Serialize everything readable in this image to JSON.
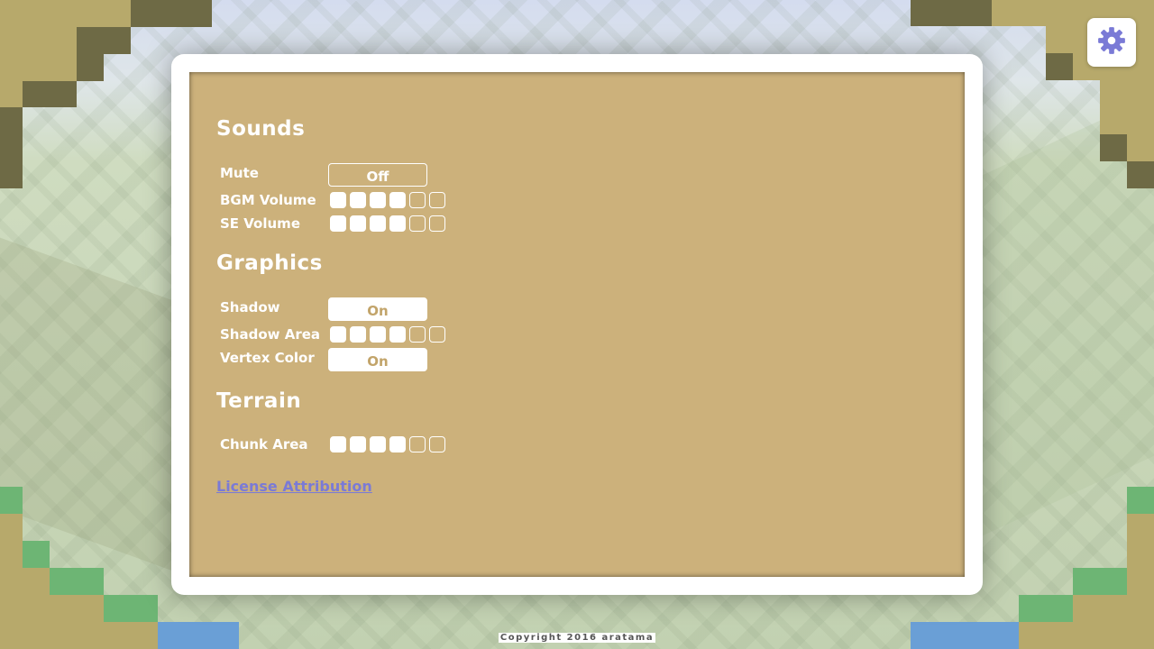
{
  "colors": {
    "panel_bg": "#ccb17b",
    "accent": "#7a7ad6",
    "frame_dark": "#6e6a45",
    "frame_sand": "#b7a96b",
    "grass": "#6db574",
    "water": "#6a9fd6"
  },
  "settings_button": {
    "icon": "gear-icon"
  },
  "sections": {
    "sounds": {
      "title": "Sounds",
      "mute": {
        "label": "Mute",
        "value": "Off"
      },
      "bgm_volume": {
        "label": "BGM Volume",
        "level": 4,
        "max": 6
      },
      "se_volume": {
        "label": "SE Volume",
        "level": 4,
        "max": 6
      }
    },
    "graphics": {
      "title": "Graphics",
      "shadow": {
        "label": "Shadow",
        "value": "On"
      },
      "shadow_area": {
        "label": "Shadow Area",
        "level": 4,
        "max": 6
      },
      "vertex_color": {
        "label": "Vertex Color",
        "value": "On"
      }
    },
    "terrain": {
      "title": "Terrain",
      "chunk_area": {
        "label": "Chunk Area",
        "level": 4,
        "max": 6
      }
    }
  },
  "license_link": "License Attribution",
  "copyright": "Copyright 2016 aratama"
}
